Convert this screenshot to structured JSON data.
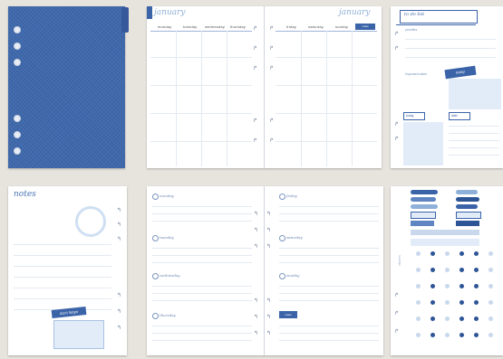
{
  "monthly": {
    "title_left": "january",
    "title_right": "january",
    "days": [
      "monday",
      "tuesday",
      "wednesday",
      "thursday",
      "friday",
      "saturday",
      "sunday",
      "notes"
    ]
  },
  "notes_page": {
    "title": "notes",
    "banner": "don't forget"
  },
  "weekly": {
    "left_days": [
      "monday",
      "tuesday",
      "wednesday",
      "thursday"
    ],
    "right_days": [
      "friday",
      "saturday",
      "sunday"
    ],
    "banner": "notes"
  },
  "todo": {
    "title": "to do list",
    "checklist_label": "priorities",
    "stickers_label": "important dates",
    "tag_a": "today",
    "tag_b": "later"
  },
  "stickers": {
    "label": "stickers"
  },
  "colors": {
    "denim": "#3f69ad",
    "accent": "#3b64a8",
    "pale": "#e2ecf8"
  },
  "icons": [
    "binder-hole-icon",
    "ring-icon",
    "arrow-icon",
    "checkbox-icon"
  ]
}
